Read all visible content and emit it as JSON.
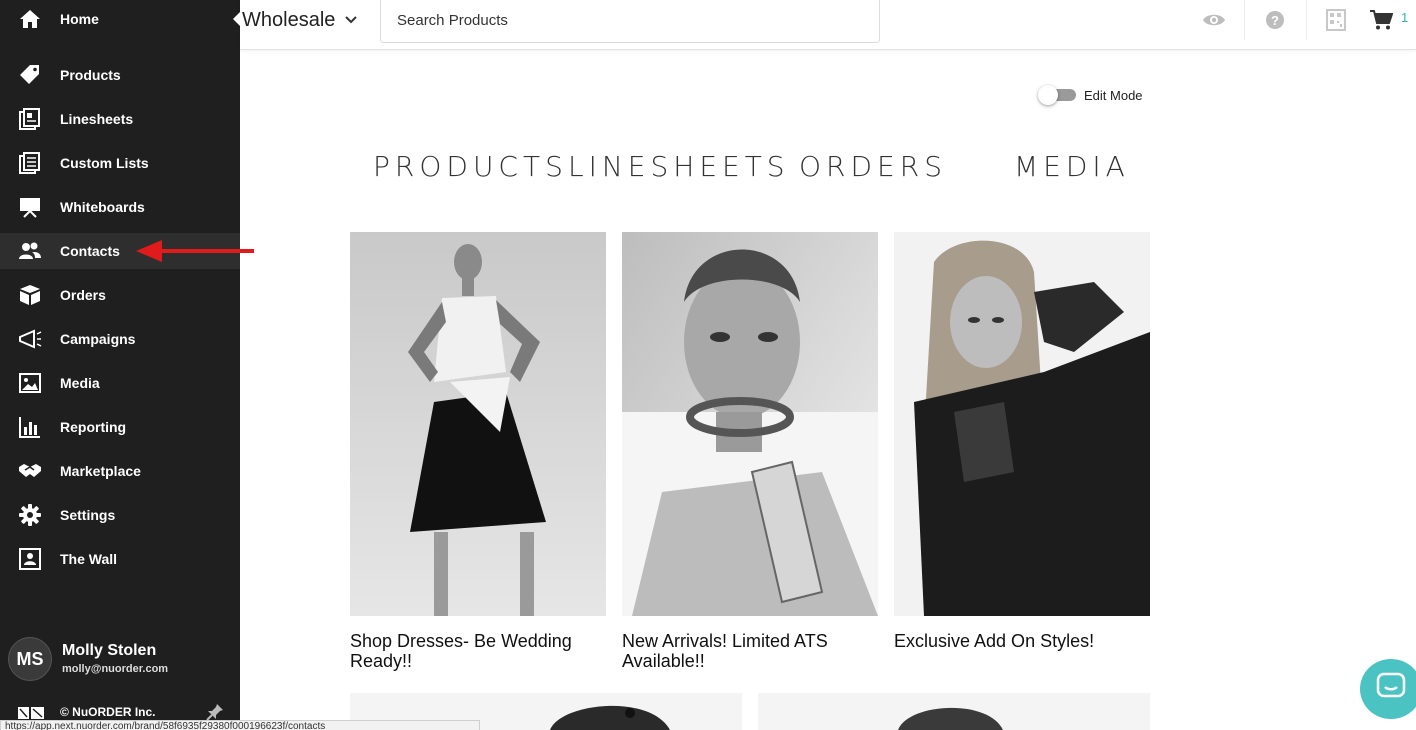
{
  "sidebar": {
    "items": [
      {
        "label": "Home",
        "icon": "home-icon"
      },
      {
        "label": "Products",
        "icon": "tag-icon"
      },
      {
        "label": "Linesheets",
        "icon": "linesheets-icon"
      },
      {
        "label": "Custom Lists",
        "icon": "list-icon"
      },
      {
        "label": "Whiteboards",
        "icon": "whiteboard-icon"
      },
      {
        "label": "Contacts",
        "icon": "contacts-icon"
      },
      {
        "label": "Orders",
        "icon": "box-icon"
      },
      {
        "label": "Campaigns",
        "icon": "campaign-icon"
      },
      {
        "label": "Media",
        "icon": "image-icon"
      },
      {
        "label": "Reporting",
        "icon": "bar-chart-icon"
      },
      {
        "label": "Marketplace",
        "icon": "handshake-icon"
      },
      {
        "label": "Settings",
        "icon": "gear-icon"
      },
      {
        "label": "The Wall",
        "icon": "wall-icon"
      }
    ],
    "active_item": "Contacts",
    "user": {
      "initials": "MS",
      "name": "Molly Stolen",
      "email": "molly@nuorder.com"
    },
    "footer": {
      "copyright": "© NuORDER Inc."
    }
  },
  "topbar": {
    "brand_select": "Wholesale",
    "search_placeholder": "Search Products",
    "cart_count": "1"
  },
  "main": {
    "edit_mode_label": "Edit Mode",
    "edit_mode_on": false,
    "hero_tabs": [
      "PRODUCTS",
      "LINESHEETS",
      "ORDERS",
      "MEDIA"
    ],
    "tiles": [
      {
        "caption": "Shop Dresses- Be Wedding Ready!!"
      },
      {
        "caption": "New Arrivals! Limited ATS Available!!"
      },
      {
        "caption": "Exclusive Add On Styles!"
      }
    ]
  },
  "status_bar": {
    "url": "https://app.next.nuorder.com/brand/58f6935f29380f000196623f/contacts"
  },
  "colors": {
    "sidebar_bg": "#1f1f1f",
    "accent": "#2bb5b5",
    "chat": "#4cc3c3",
    "annotation": "#e01b1b"
  }
}
